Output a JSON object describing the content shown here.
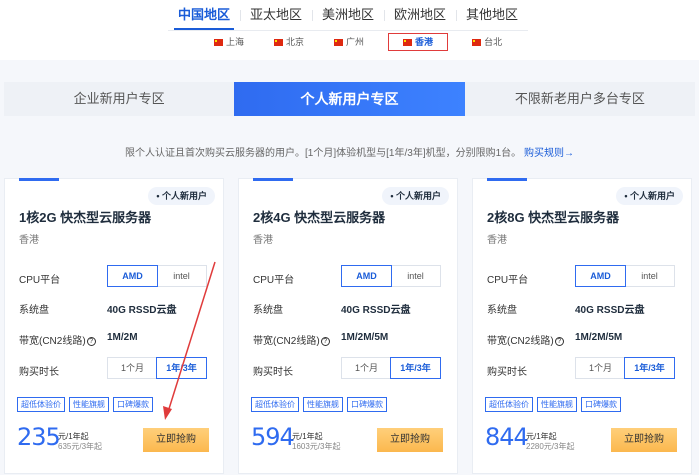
{
  "regions": {
    "tabs": [
      "中国地区",
      "亚太地区",
      "美洲地区",
      "欧洲地区",
      "其他地区"
    ],
    "active": 0
  },
  "cities": [
    {
      "label": "上海",
      "active": false
    },
    {
      "label": "北京",
      "active": false
    },
    {
      "label": "广州",
      "active": false
    },
    {
      "label": "香港",
      "active": true
    },
    {
      "label": "台北",
      "active": false
    }
  ],
  "zones": {
    "tabs": [
      "企业新用户专区",
      "个人新用户专区",
      "不限新老用户多台专区"
    ],
    "active": 1
  },
  "notice": {
    "text": "限个人认证且首次购买云服务器的用户。[1个月]体验机型与[1年/3年]机型，分别限购1台。",
    "link": "购买规则→"
  },
  "labels": {
    "cpu": "CPU平台",
    "disk": "系统盘",
    "bandwidth": "带宽(CN2线路)",
    "duration": "购买时长",
    "help": "?"
  },
  "cards": [
    {
      "badge": "个人新用户",
      "title": "1核2G 快杰型云服务器",
      "region": "香港",
      "cpu_options": [
        "AMD",
        "intel"
      ],
      "cpu_active": 0,
      "disk": "40G RSSD云盘",
      "bandwidth": "1M/2M",
      "duration_options": [
        "1个月",
        "1年/3年"
      ],
      "duration_active": 1,
      "tags": [
        "超低体验价",
        "性能旗舰",
        "口碑爆款"
      ],
      "price": "235",
      "price_unit": "元/1年起",
      "price_orig": "635元/3年起",
      "buy": "立即抢购"
    },
    {
      "badge": "个人新用户",
      "title": "2核4G 快杰型云服务器",
      "region": "香港",
      "cpu_options": [
        "AMD",
        "intel"
      ],
      "cpu_active": 0,
      "disk": "40G RSSD云盘",
      "bandwidth": "1M/2M/5M",
      "duration_options": [
        "1个月",
        "1年/3年"
      ],
      "duration_active": 1,
      "tags": [
        "超低体验价",
        "性能旗舰",
        "口碑爆款"
      ],
      "price": "594",
      "price_unit": "元/1年起",
      "price_orig": "1603元/3年起",
      "buy": "立即抢购"
    },
    {
      "badge": "个人新用户",
      "title": "2核8G 快杰型云服务器",
      "region": "香港",
      "cpu_options": [
        "AMD",
        "intel"
      ],
      "cpu_active": 0,
      "disk": "40G RSSD云盘",
      "bandwidth": "1M/2M/5M",
      "duration_options": [
        "1个月",
        "1年/3年"
      ],
      "duration_active": 1,
      "tags": [
        "超低体验价",
        "性能旗舰",
        "口碑爆款"
      ],
      "price": "844",
      "price_unit": "元/1年起",
      "price_orig": "2280元/3年起",
      "buy": "立即抢购"
    }
  ],
  "colors": {
    "accent": "#2f6bf0",
    "annotation": "#e03b3b",
    "buy": "#fbb84e"
  }
}
